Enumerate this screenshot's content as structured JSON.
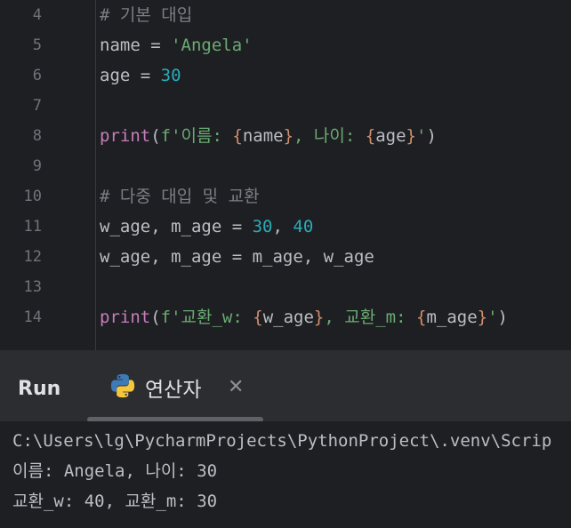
{
  "editor": {
    "lines": [
      {
        "num": "4",
        "tokens": [
          {
            "t": "# 기본 대입",
            "c": "k-com"
          }
        ]
      },
      {
        "num": "5",
        "tokens": [
          {
            "t": "name = ",
            "c": "k-id"
          },
          {
            "t": "'Angela'",
            "c": "k-str"
          }
        ]
      },
      {
        "num": "6",
        "tokens": [
          {
            "t": "age = ",
            "c": "k-id"
          },
          {
            "t": "30",
            "c": "k-num"
          }
        ]
      },
      {
        "num": "7",
        "tokens": []
      },
      {
        "num": "8",
        "tokens": [
          {
            "t": "print",
            "c": "k-fn"
          },
          {
            "t": "(",
            "c": "k-id"
          },
          {
            "t": "f'이름: ",
            "c": "k-str"
          },
          {
            "t": "{",
            "c": "k-brace"
          },
          {
            "t": "name",
            "c": "k-id"
          },
          {
            "t": "}",
            "c": "k-brace"
          },
          {
            "t": ", 나이: ",
            "c": "k-str"
          },
          {
            "t": "{",
            "c": "k-brace"
          },
          {
            "t": "age",
            "c": "k-id"
          },
          {
            "t": "}",
            "c": "k-brace"
          },
          {
            "t": "'",
            "c": "k-str"
          },
          {
            "t": ")",
            "c": "k-id"
          }
        ]
      },
      {
        "num": "9",
        "tokens": []
      },
      {
        "num": "10",
        "tokens": [
          {
            "t": "# 다중 대입 및 교환",
            "c": "k-com"
          }
        ]
      },
      {
        "num": "11",
        "tokens": [
          {
            "t": "w_age, m_age = ",
            "c": "k-id"
          },
          {
            "t": "30",
            "c": "k-num"
          },
          {
            "t": ", ",
            "c": "k-id"
          },
          {
            "t": "40",
            "c": "k-num"
          }
        ]
      },
      {
        "num": "12",
        "tokens": [
          {
            "t": "w_age, m_age = m_age, w_age",
            "c": "k-id"
          }
        ]
      },
      {
        "num": "13",
        "tokens": []
      },
      {
        "num": "14",
        "tokens": [
          {
            "t": "print",
            "c": "k-fn"
          },
          {
            "t": "(",
            "c": "k-id"
          },
          {
            "t": "f'교환_w: ",
            "c": "k-str"
          },
          {
            "t": "{",
            "c": "k-brace"
          },
          {
            "t": "w_age",
            "c": "k-id"
          },
          {
            "t": "}",
            "c": "k-brace"
          },
          {
            "t": ", 교환_m: ",
            "c": "k-str"
          },
          {
            "t": "{",
            "c": "k-brace"
          },
          {
            "t": "m_age",
            "c": "k-id"
          },
          {
            "t": "}",
            "c": "k-brace"
          },
          {
            "t": "'",
            "c": "k-str"
          },
          {
            "t": ")",
            "c": "k-id"
          }
        ]
      }
    ]
  },
  "run_panel": {
    "title": "Run",
    "tab_label": "연산자",
    "tab_icon": "python-icon",
    "close_glyph": "✕"
  },
  "console": {
    "lines": [
      "C:\\Users\\lg\\PycharmProjects\\PythonProject\\.venv\\Scrip",
      "이름: Angela, 나이: 30",
      "교환_w: 40, 교환_m: 30"
    ]
  },
  "colors": {
    "background": "#1e1f22",
    "panel": "#2b2d30",
    "comment": "#7a7e85",
    "string": "#6aab73",
    "number": "#2aacb8",
    "builtin": "#c77dbb",
    "brace": "#cf8e6d",
    "text": "#bcbec4"
  }
}
